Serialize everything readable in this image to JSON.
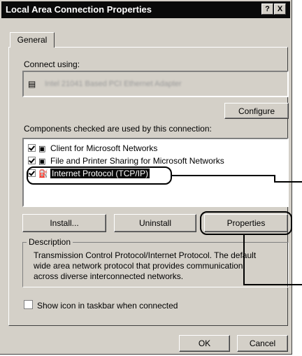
{
  "window": {
    "title": "Local Area Connection Properties",
    "help_label": "?",
    "close_label": "X"
  },
  "tabs": [
    {
      "label": "General",
      "active": true
    }
  ],
  "connect_using": {
    "label": "Connect using:",
    "adapter_name": "Intel 21041 Based PCI Ethernet Adapter"
  },
  "configure_label": "Configure",
  "components": {
    "label": "Components checked are used by this connection:",
    "items": [
      {
        "label": "Client for Microsoft Networks",
        "checked": true,
        "selected": false
      },
      {
        "label": "File and Printer Sharing for Microsoft Networks",
        "checked": true,
        "selected": false
      },
      {
        "label": "Internet Protocol (TCP/IP)",
        "checked": true,
        "selected": true
      }
    ]
  },
  "actions": {
    "install_label": "Install...",
    "uninstall_label": "Uninstall",
    "properties_label": "Properties"
  },
  "description": {
    "title": "Description",
    "text": "Transmission Control Protocol/Internet Protocol. The default wide area network protocol that provides communication across diverse interconnected networks."
  },
  "taskbar_option": {
    "label": "Show icon in taskbar when connected",
    "checked": false
  },
  "footer": {
    "ok_label": "OK",
    "cancel_label": "Cancel"
  },
  "colors": {
    "dialog_face": "#d4d0c8",
    "titlebar": "#0a0a0a",
    "selection": "#0a0a0a"
  }
}
